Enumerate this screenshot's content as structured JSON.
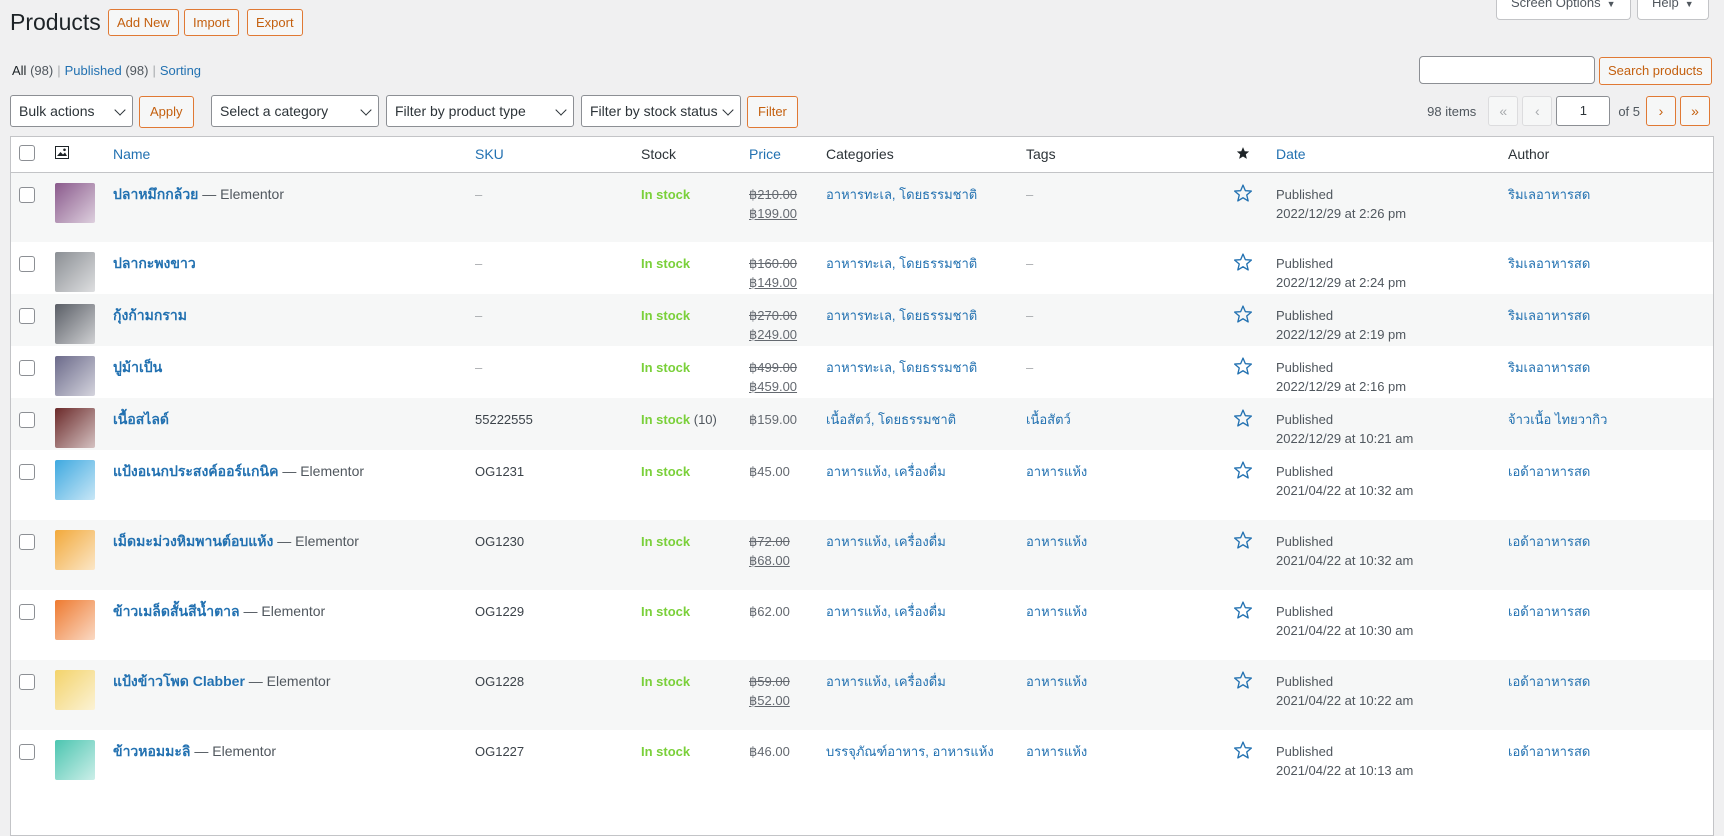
{
  "page": {
    "title": "Products",
    "add_new": "Add New",
    "import": "Import",
    "export": "Export",
    "screen_options": "Screen Options",
    "help": "Help"
  },
  "views": {
    "all": "All",
    "all_count": "(98)",
    "published": "Published",
    "published_count": "(98)",
    "sorting": "Sorting",
    "separator": "|"
  },
  "search": {
    "button": "Search products",
    "value": ""
  },
  "filters": {
    "bulk_actions": "Bulk actions",
    "apply": "Apply",
    "category": "Select a category",
    "product_type": "Filter by product type",
    "stock_status": "Filter by stock status",
    "filter": "Filter"
  },
  "pagination": {
    "items": "98 items",
    "first": "«",
    "prev": "‹",
    "current": "1",
    "of": "of 5",
    "next": "›",
    "last": "»"
  },
  "columns": {
    "name": "Name",
    "sku": "SKU",
    "stock": "Stock",
    "price": "Price",
    "categories": "Categories",
    "tags": "Tags",
    "date": "Date",
    "author": "Author"
  },
  "icons": {
    "thumbnail_header": "image-icon",
    "featured_header": "star-filled-icon",
    "featured_row": "star-outline-icon",
    "accent": "#e07934",
    "link": "#2271b1",
    "instock": "#7ad03a"
  },
  "rows": [
    {
      "name": "ปลาหมึกกล้วย",
      "suffix": " — Elementor",
      "sku": "–",
      "stock": "In stock",
      "stock_qty": "",
      "price_old": "฿210.00",
      "price_new": "฿199.00",
      "price": "",
      "categories": "อาหารทะเล, โดยธรรมชาติ",
      "tags": "–",
      "date_status": "Published",
      "date": "2022/12/29 at 2:26 pm",
      "author": "ริมเลอาหารสด",
      "thumb": "#8a5a8c"
    },
    {
      "name": "ปลากะพงขาว",
      "suffix": "",
      "sku": "–",
      "stock": "In stock",
      "stock_qty": "",
      "price_old": "฿160.00",
      "price_new": "฿149.00",
      "price": "",
      "categories": "อาหารทะเล, โดยธรรมชาติ",
      "tags": "–",
      "date_status": "Published",
      "date": "2022/12/29 at 2:24 pm",
      "author": "ริมเลอาหารสด",
      "thumb": "#8b8f94"
    },
    {
      "name": "กุ้งก้ามกราม",
      "suffix": "",
      "sku": "–",
      "stock": "In stock",
      "stock_qty": "",
      "price_old": "฿270.00",
      "price_new": "฿249.00",
      "price": "",
      "categories": "อาหารทะเล, โดยธรรมชาติ",
      "tags": "–",
      "date_status": "Published",
      "date": "2022/12/29 at 2:19 pm",
      "author": "ริมเลอาหารสด",
      "thumb": "#5a5e66"
    },
    {
      "name": "ปูม้าเป็น",
      "suffix": "",
      "sku": "–",
      "stock": "In stock",
      "stock_qty": "",
      "price_old": "฿499.00",
      "price_new": "฿459.00",
      "price": "",
      "categories": "อาหารทะเล, โดยธรรมชาติ",
      "tags": "–",
      "date_status": "Published",
      "date": "2022/12/29 at 2:16 pm",
      "author": "ริมเลอาหารสด",
      "thumb": "#6b6a8a"
    },
    {
      "name": "เนื้อสไลด์",
      "suffix": "",
      "sku": "55222555",
      "stock": "In stock",
      "stock_qty": " (10)",
      "price_old": "",
      "price_new": "",
      "price": "฿159.00",
      "categories": "เนื้อสัตว์, โดยธรรมชาติ",
      "tags": "เนื้อสัตว์",
      "date_status": "Published",
      "date": "2022/12/29 at 10:21 am",
      "author": "จ้าวเนื้อ ไทยวากิว",
      "thumb": "#6b2a2a"
    },
    {
      "name": "แป้งอเนกประสงค์ออร์แกนิค",
      "suffix": " — Elementor",
      "sku": "OG1231",
      "stock": "In stock",
      "stock_qty": "",
      "price_old": "",
      "price_new": "",
      "price": "฿45.00",
      "categories": "อาหารแห้ง, เครื่องดื่ม",
      "tags": "อาหารแห้ง",
      "date_status": "Published",
      "date": "2021/04/22 at 10:32 am",
      "author": "เอด้าอาหารสด",
      "thumb": "#3fa9e0"
    },
    {
      "name": "เม็ดมะม่วงหิมพานต์อบแห้ง",
      "suffix": " — Elementor",
      "sku": "OG1230",
      "stock": "In stock",
      "stock_qty": "",
      "price_old": "฿72.00",
      "price_new": "฿68.00",
      "price": "",
      "categories": "อาหารแห้ง, เครื่องดื่ม",
      "tags": "อาหารแห้ง",
      "date_status": "Published",
      "date": "2021/04/22 at 10:32 am",
      "author": "เอด้าอาหารสด",
      "thumb": "#f2a93b"
    },
    {
      "name": "ข้าวเมล็ดสั้นสีน้ำตาล",
      "suffix": " — Elementor",
      "sku": "OG1229",
      "stock": "In stock",
      "stock_qty": "",
      "price_old": "",
      "price_new": "",
      "price": "฿62.00",
      "categories": "อาหารแห้ง, เครื่องดื่ม",
      "tags": "อาหารแห้ง",
      "date_status": "Published",
      "date": "2021/04/22 at 10:30 am",
      "author": "เอด้าอาหารสด",
      "thumb": "#ee7a30"
    },
    {
      "name": "แป้งข้าวโพด Clabber",
      "suffix": " — Elementor",
      "sku": "OG1228",
      "stock": "In stock",
      "stock_qty": "",
      "price_old": "฿59.00",
      "price_new": "฿52.00",
      "price": "",
      "categories": "อาหารแห้ง, เครื่องดื่ม",
      "tags": "อาหารแห้ง",
      "date_status": "Published",
      "date": "2021/04/22 at 10:22 am",
      "author": "เอด้าอาหารสด",
      "thumb": "#f3d36b"
    },
    {
      "name": "ข้าวหอมมะลิ",
      "suffix": " — Elementor",
      "sku": "OG1227",
      "stock": "In stock",
      "stock_qty": "",
      "price_old": "",
      "price_new": "",
      "price": "฿46.00",
      "categories": "บรรจุภัณฑ์อาหาร, อาหารแห้ง",
      "tags": "อาหารแห้ง",
      "date_status": "Published",
      "date": "2021/04/22 at 10:13 am",
      "author": "เอด้าอาหารสด",
      "thumb": "#4cc5b0"
    }
  ]
}
